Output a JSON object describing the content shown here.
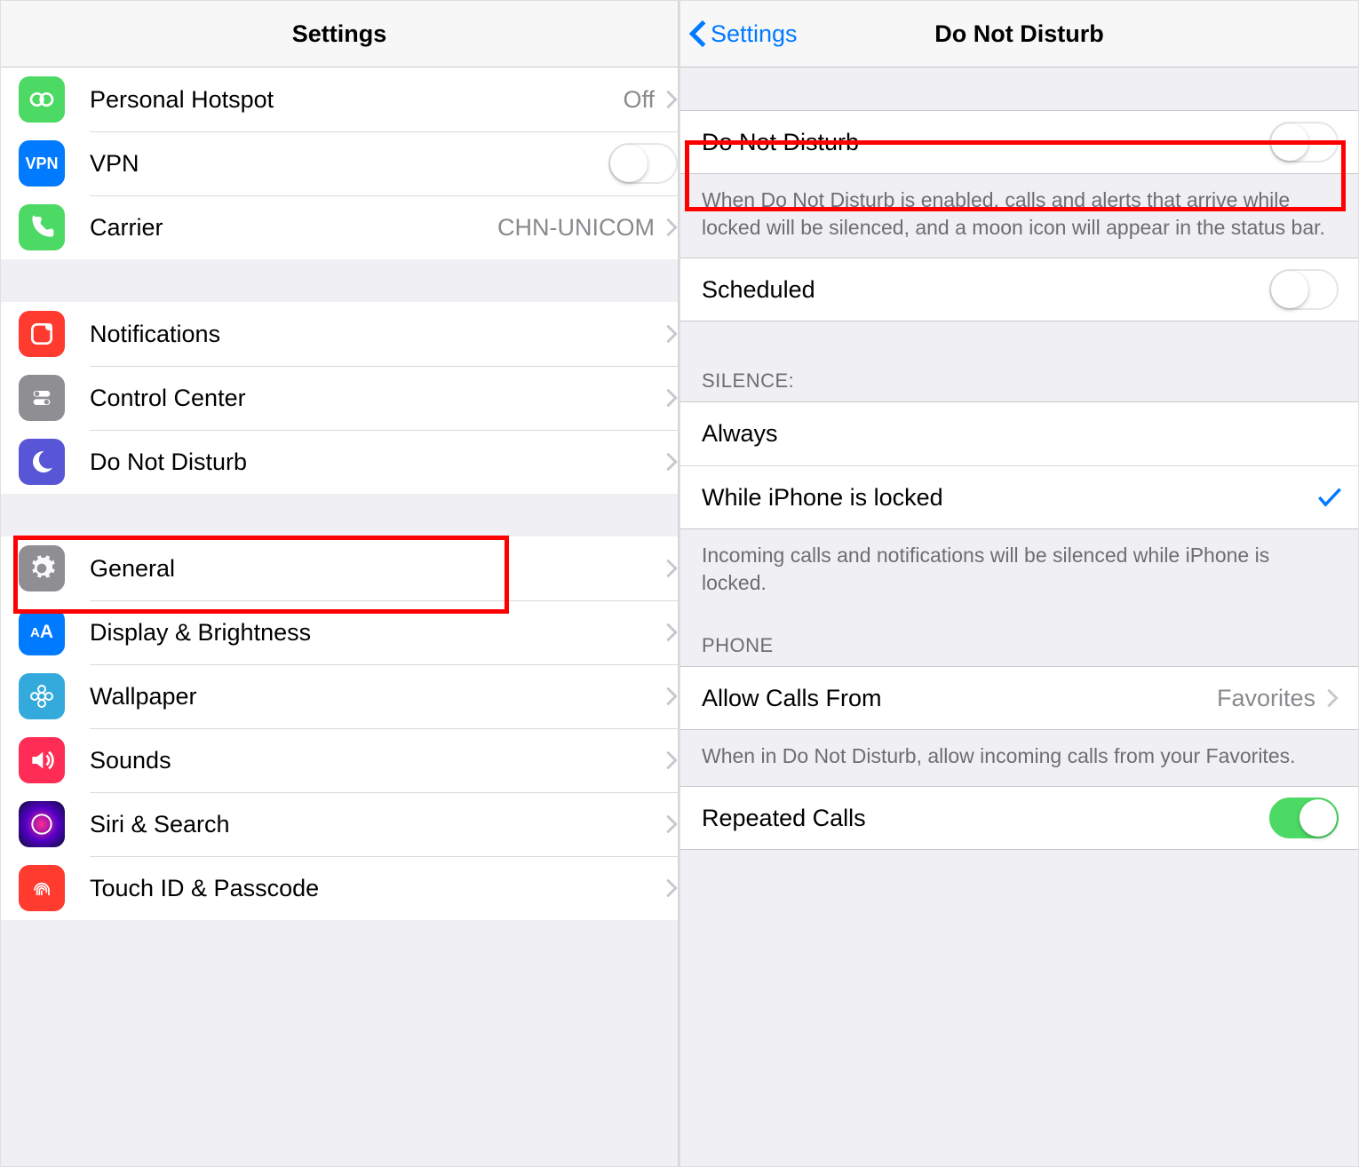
{
  "left": {
    "title": "Settings",
    "groups": [
      {
        "items": [
          {
            "icon": "hotspot",
            "color": "#4cd964",
            "label": "Personal Hotspot",
            "value": "Off",
            "chevron": true
          },
          {
            "icon": "vpn",
            "color": "#007aff",
            "label": "VPN",
            "toggle": false
          },
          {
            "icon": "phone",
            "color": "#4cd964",
            "label": "Carrier",
            "value": "CHN-UNICOM",
            "chevron": true
          }
        ]
      },
      {
        "items": [
          {
            "icon": "notifications",
            "color": "#ff3b30",
            "label": "Notifications",
            "chevron": true
          },
          {
            "icon": "control-center",
            "color": "#8e8e93",
            "label": "Control Center",
            "chevron": true
          },
          {
            "icon": "moon",
            "color": "#5856d6",
            "label": "Do Not Disturb",
            "chevron": true
          }
        ]
      },
      {
        "items": [
          {
            "icon": "gear",
            "color": "#8e8e93",
            "label": "General",
            "chevron": true
          },
          {
            "icon": "aa",
            "color": "#007aff",
            "label": "Display & Brightness",
            "chevron": true
          },
          {
            "icon": "wallpaper",
            "color": "#34aadc",
            "label": "Wallpaper",
            "chevron": true
          },
          {
            "icon": "sounds",
            "color": "#ff2d55",
            "label": "Sounds",
            "chevron": true
          },
          {
            "icon": "siri",
            "color": "#000000",
            "label": "Siri & Search",
            "chevron": true
          },
          {
            "icon": "touchid",
            "color": "#ff3b30",
            "label": "Touch ID & Passcode",
            "chevron": true
          }
        ]
      }
    ]
  },
  "right": {
    "back": "Settings",
    "title": "Do Not Disturb",
    "sections": [
      {
        "rows": [
          {
            "label": "Do Not Disturb",
            "toggle": false
          }
        ],
        "footer": "When Do Not Disturb is enabled, calls and alerts that arrive while locked will be silenced, and a moon icon will appear in the status bar."
      },
      {
        "rows": [
          {
            "label": "Scheduled",
            "toggle": false
          }
        ]
      },
      {
        "header": "SILENCE:",
        "rows": [
          {
            "label": "Always"
          },
          {
            "label": "While iPhone is locked",
            "checked": true
          }
        ],
        "footer": "Incoming calls and notifications will be silenced while iPhone is locked."
      },
      {
        "header": "PHONE",
        "rows": [
          {
            "label": "Allow Calls From",
            "value": "Favorites",
            "chevron": true
          }
        ],
        "footer": "When in Do Not Disturb, allow incoming calls from your Favorites."
      },
      {
        "rows": [
          {
            "label": "Repeated Calls",
            "toggle": true
          }
        ]
      }
    ]
  }
}
